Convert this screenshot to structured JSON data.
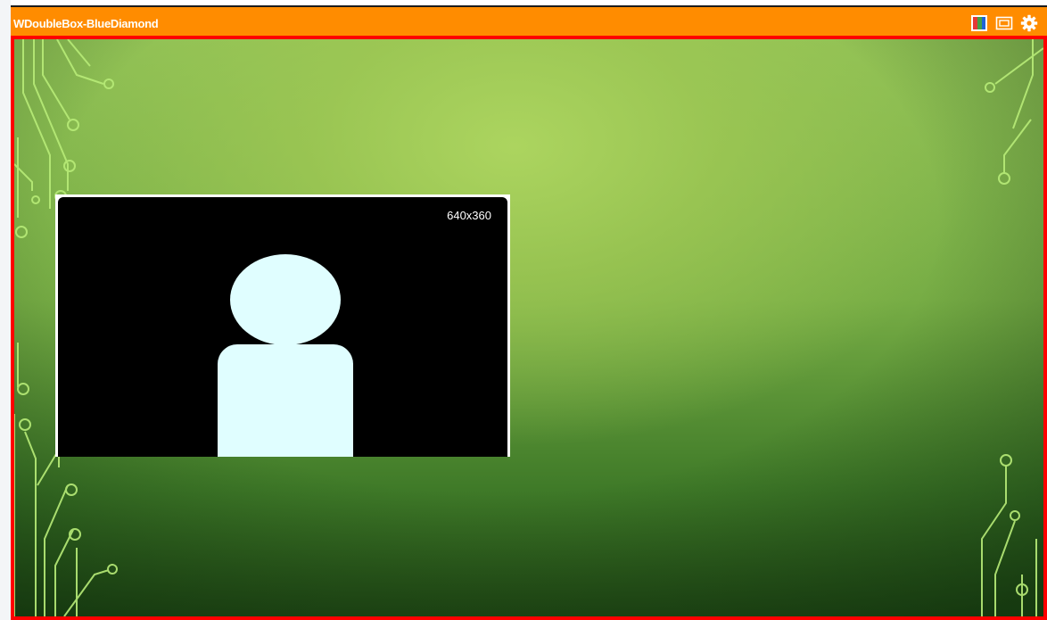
{
  "window": {
    "title": "WDoubleBox-BlueDiamond"
  },
  "toolbar": {
    "icons": [
      "color-palette-icon",
      "picture-in-picture-icon",
      "gear-icon"
    ]
  },
  "video": {
    "resolution_label": "640x360"
  },
  "colors": {
    "titlebar": "#ff8c00",
    "stage_border": "#ff0000",
    "avatar": "#e0feff"
  }
}
